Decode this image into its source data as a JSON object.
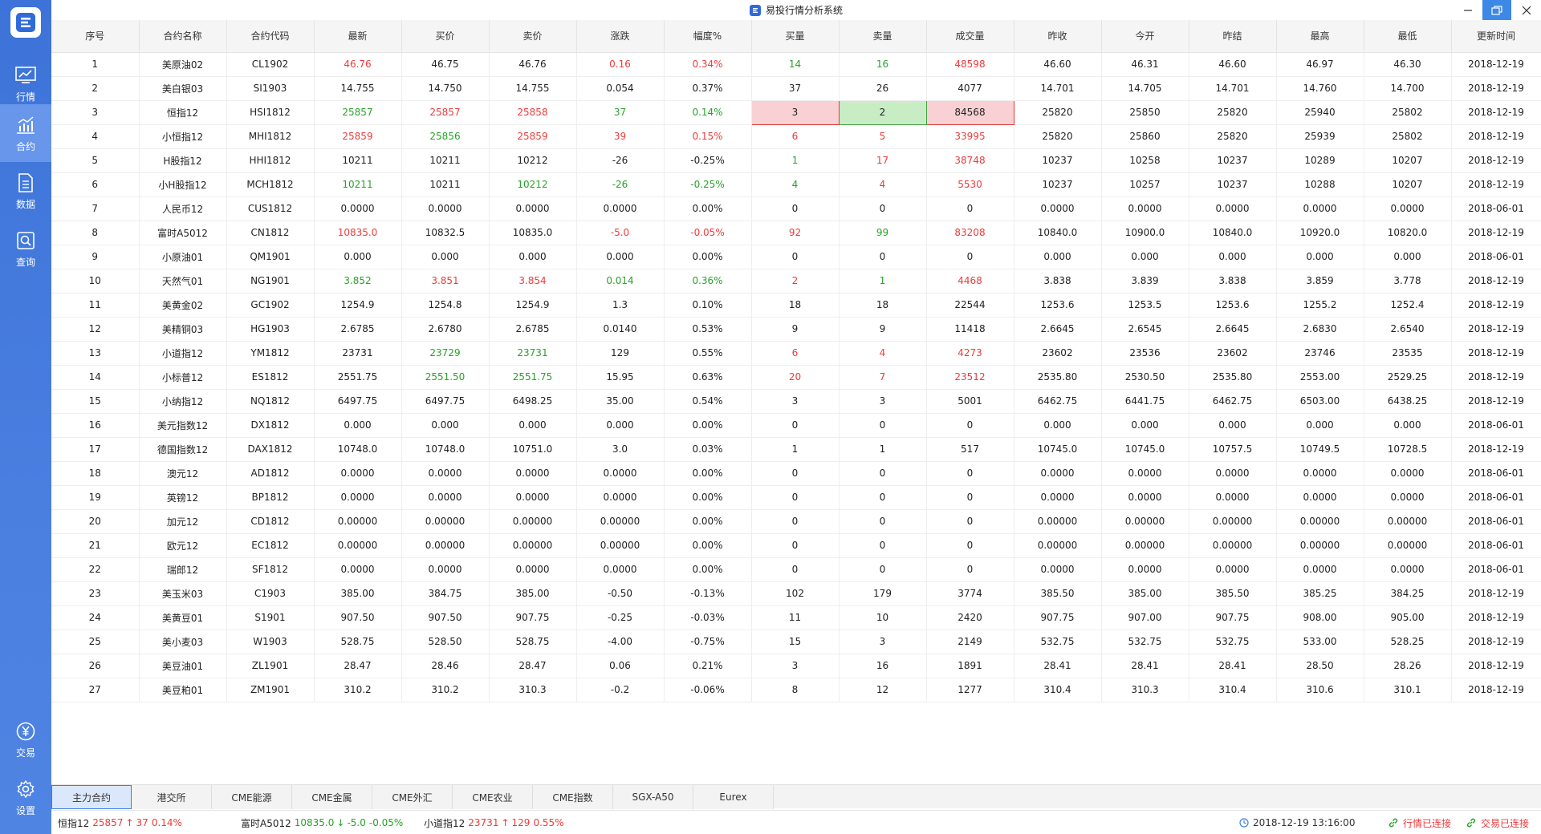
{
  "window": {
    "title": "易投行情分析系统"
  },
  "sidebar": {
    "items": [
      {
        "label": "行情",
        "icon": "chart-line-icon"
      },
      {
        "label": "合约",
        "icon": "bar-chart-icon"
      },
      {
        "label": "数据",
        "icon": "document-icon"
      },
      {
        "label": "查询",
        "icon": "search-icon"
      },
      {
        "label": "交易",
        "icon": "yen-coin-icon"
      },
      {
        "label": "设置",
        "icon": "gear-icon"
      }
    ]
  },
  "table": {
    "columns": [
      "序号",
      "合约名称",
      "合约代码",
      "最新",
      "买价",
      "卖价",
      "涨跌",
      "幅度%",
      "买量",
      "卖量",
      "成交量",
      "昨收",
      "今开",
      "昨结",
      "最高",
      "最低",
      "更新时间"
    ],
    "rows": [
      [
        "1",
        "美原油02",
        "CL1902",
        "46.76",
        "46.75",
        "46.76",
        "0.16",
        "0.34%",
        "14",
        "16",
        "48598",
        "46.60",
        "46.31",
        "46.60",
        "46.97",
        "46.30",
        "2018-12-19"
      ],
      [
        "2",
        "美白银03",
        "SI1903",
        "14.755",
        "14.750",
        "14.755",
        "0.054",
        "0.37%",
        "37",
        "26",
        "4077",
        "14.701",
        "14.705",
        "14.701",
        "14.760",
        "14.700",
        "2018-12-19"
      ],
      [
        "3",
        "恒指12",
        "HSI1812",
        "25857",
        "25857",
        "25858",
        "37",
        "0.14%",
        "3",
        "2",
        "84568",
        "25820",
        "25850",
        "25820",
        "25940",
        "25802",
        "2018-12-19"
      ],
      [
        "4",
        "小恒指12",
        "MHI1812",
        "25859",
        "25856",
        "25859",
        "39",
        "0.15%",
        "6",
        "5",
        "33995",
        "25820",
        "25860",
        "25820",
        "25939",
        "25802",
        "2018-12-19"
      ],
      [
        "5",
        "H股指12",
        "HHI1812",
        "10211",
        "10211",
        "10212",
        "-26",
        "-0.25%",
        "1",
        "17",
        "38748",
        "10237",
        "10258",
        "10237",
        "10289",
        "10207",
        "2018-12-19"
      ],
      [
        "6",
        "小H股指12",
        "MCH1812",
        "10211",
        "10211",
        "10212",
        "-26",
        "-0.25%",
        "4",
        "4",
        "5530",
        "10237",
        "10257",
        "10237",
        "10288",
        "10207",
        "2018-12-19"
      ],
      [
        "7",
        "人民币12",
        "CUS1812",
        "0.0000",
        "0.0000",
        "0.0000",
        "0.0000",
        "0.00%",
        "0",
        "0",
        "0",
        "0.0000",
        "0.0000",
        "0.0000",
        "0.0000",
        "0.0000",
        "2018-06-01"
      ],
      [
        "8",
        "富时A5012",
        "CN1812",
        "10835.0",
        "10832.5",
        "10835.0",
        "-5.0",
        "-0.05%",
        "92",
        "99",
        "83208",
        "10840.0",
        "10900.0",
        "10840.0",
        "10920.0",
        "10820.0",
        "2018-12-19"
      ],
      [
        "9",
        "小原油01",
        "QM1901",
        "0.000",
        "0.000",
        "0.000",
        "0.000",
        "0.00%",
        "0",
        "0",
        "0",
        "0.000",
        "0.000",
        "0.000",
        "0.000",
        "0.000",
        "2018-06-01"
      ],
      [
        "10",
        "天然气01",
        "NG1901",
        "3.852",
        "3.851",
        "3.854",
        "0.014",
        "0.36%",
        "2",
        "1",
        "4468",
        "3.838",
        "3.839",
        "3.838",
        "3.859",
        "3.778",
        "2018-12-19"
      ],
      [
        "11",
        "美黄金02",
        "GC1902",
        "1254.9",
        "1254.8",
        "1254.9",
        "1.3",
        "0.10%",
        "18",
        "18",
        "22544",
        "1253.6",
        "1253.5",
        "1253.6",
        "1255.2",
        "1252.4",
        "2018-12-19"
      ],
      [
        "12",
        "美精铜03",
        "HG1903",
        "2.6785",
        "2.6780",
        "2.6785",
        "0.0140",
        "0.53%",
        "9",
        "9",
        "11418",
        "2.6645",
        "2.6545",
        "2.6645",
        "2.6830",
        "2.6540",
        "2018-12-19"
      ],
      [
        "13",
        "小道指12",
        "YM1812",
        "23731",
        "23729",
        "23731",
        "129",
        "0.55%",
        "6",
        "4",
        "4273",
        "23602",
        "23536",
        "23602",
        "23746",
        "23535",
        "2018-12-19"
      ],
      [
        "14",
        "小标普12",
        "ES1812",
        "2551.75",
        "2551.50",
        "2551.75",
        "15.95",
        "0.63%",
        "20",
        "7",
        "23512",
        "2535.80",
        "2530.50",
        "2535.80",
        "2553.00",
        "2529.25",
        "2018-12-19"
      ],
      [
        "15",
        "小纳指12",
        "NQ1812",
        "6497.75",
        "6497.75",
        "6498.25",
        "35.00",
        "0.54%",
        "3",
        "3",
        "5001",
        "6462.75",
        "6441.75",
        "6462.75",
        "6503.00",
        "6438.25",
        "2018-12-19"
      ],
      [
        "16",
        "美元指数12",
        "DX1812",
        "0.000",
        "0.000",
        "0.000",
        "0.000",
        "0.00%",
        "0",
        "0",
        "0",
        "0.000",
        "0.000",
        "0.000",
        "0.000",
        "0.000",
        "2018-06-01"
      ],
      [
        "17",
        "德国指数12",
        "DAX1812",
        "10748.0",
        "10748.0",
        "10751.0",
        "3.0",
        "0.03%",
        "1",
        "1",
        "517",
        "10745.0",
        "10745.0",
        "10757.5",
        "10749.5",
        "10728.5",
        "2018-12-19"
      ],
      [
        "18",
        "澳元12",
        "AD1812",
        "0.0000",
        "0.0000",
        "0.0000",
        "0.0000",
        "0.00%",
        "0",
        "0",
        "0",
        "0.0000",
        "0.0000",
        "0.0000",
        "0.0000",
        "0.0000",
        "2018-06-01"
      ],
      [
        "19",
        "英镑12",
        "BP1812",
        "0.0000",
        "0.0000",
        "0.0000",
        "0.0000",
        "0.00%",
        "0",
        "0",
        "0",
        "0.0000",
        "0.0000",
        "0.0000",
        "0.0000",
        "0.0000",
        "2018-06-01"
      ],
      [
        "20",
        "加元12",
        "CD1812",
        "0.00000",
        "0.00000",
        "0.00000",
        "0.00000",
        "0.00%",
        "0",
        "0",
        "0",
        "0.00000",
        "0.00000",
        "0.00000",
        "0.00000",
        "0.00000",
        "2018-06-01"
      ],
      [
        "21",
        "欧元12",
        "EC1812",
        "0.00000",
        "0.00000",
        "0.00000",
        "0.00000",
        "0.00%",
        "0",
        "0",
        "0",
        "0.00000",
        "0.00000",
        "0.00000",
        "0.00000",
        "0.00000",
        "2018-06-01"
      ],
      [
        "22",
        "瑞郎12",
        "SF1812",
        "0.0000",
        "0.0000",
        "0.0000",
        "0.0000",
        "0.00%",
        "0",
        "0",
        "0",
        "0.0000",
        "0.0000",
        "0.0000",
        "0.0000",
        "0.0000",
        "2018-06-01"
      ],
      [
        "23",
        "美玉米03",
        "C1903",
        "385.00",
        "384.75",
        "385.00",
        "-0.50",
        "-0.13%",
        "102",
        "179",
        "3774",
        "385.50",
        "385.00",
        "385.50",
        "385.25",
        "384.25",
        "2018-12-19"
      ],
      [
        "24",
        "美黄豆01",
        "S1901",
        "907.50",
        "907.50",
        "907.75",
        "-0.25",
        "-0.03%",
        "11",
        "10",
        "2420",
        "907.75",
        "907.00",
        "907.75",
        "908.00",
        "905.00",
        "2018-12-19"
      ],
      [
        "25",
        "美小麦03",
        "W1903",
        "528.75",
        "528.50",
        "528.75",
        "-4.00",
        "-0.75%",
        "15",
        "3",
        "2149",
        "532.75",
        "532.75",
        "532.75",
        "533.00",
        "528.25",
        "2018-12-19"
      ],
      [
        "26",
        "美豆油01",
        "ZL1901",
        "28.47",
        "28.46",
        "28.47",
        "0.06",
        "0.21%",
        "3",
        "16",
        "1891",
        "28.41",
        "28.41",
        "28.41",
        "28.50",
        "28.26",
        "2018-12-19"
      ],
      [
        "27",
        "美豆粕01",
        "ZM1901",
        "310.2",
        "310.2",
        "310.3",
        "-0.2",
        "-0.06%",
        "8",
        "12",
        "1277",
        "310.4",
        "310.3",
        "310.4",
        "310.6",
        "310.1",
        "2018-12-19"
      ]
    ],
    "cell_colors": {
      "0": {
        "3": "r",
        "6": "r",
        "7": "r",
        "8": "g",
        "9": "g",
        "10": "r"
      },
      "2": {
        "3": "g",
        "4": "r",
        "5": "r",
        "6": "g",
        "7": "g",
        "8": "hl-r",
        "9": "hl-g",
        "10": "hl-r"
      },
      "3": {
        "3": "r",
        "4": "g",
        "5": "r",
        "6": "r",
        "7": "r",
        "8": "r",
        "9": "r",
        "10": "r"
      },
      "4": {
        "8": "g",
        "9": "r",
        "10": "r"
      },
      "5": {
        "3": "g",
        "5": "g",
        "6": "g",
        "7": "g",
        "8": "g",
        "9": "r",
        "10": "r"
      },
      "7": {
        "3": "r",
        "6": "r",
        "7": "r",
        "8": "r",
        "9": "g",
        "10": "r"
      },
      "9": {
        "3": "g",
        "4": "r",
        "5": "r",
        "6": "g",
        "7": "g",
        "8": "r",
        "9": "g",
        "10": "r"
      },
      "12": {
        "4": "g",
        "5": "g",
        "8": "r",
        "9": "r",
        "10": "r"
      },
      "13": {
        "4": "g",
        "5": "g",
        "8": "r",
        "9": "r",
        "10": "r"
      }
    }
  },
  "tabs": [
    "主力合约",
    "港交所",
    "CME能源",
    "CME金属",
    "CME外汇",
    "CME农业",
    "CME指数",
    "SGX-A50",
    "Eurex"
  ],
  "active_tab": 0,
  "ticker": [
    {
      "name": "恒指12",
      "price": "25857",
      "arrow": "↑",
      "change": "37",
      "pct": "0.14%",
      "color": "r"
    },
    {
      "name": "富时A5012",
      "price": "10835.0",
      "arrow": "↓",
      "change": "-5.0",
      "pct": "-0.05%",
      "color": "g"
    },
    {
      "name": "小道指12",
      "price": "23731",
      "arrow": "↑",
      "change": "129",
      "pct": "0.55%",
      "color": "r"
    }
  ],
  "status": {
    "time": "2018-12-19 13:16:00",
    "quote_conn": "行情已连接",
    "trade_conn": "交易已连接"
  },
  "colors": {
    "up": "#f03a3a",
    "down": "#27a327",
    "accent": "#3d73d8"
  }
}
